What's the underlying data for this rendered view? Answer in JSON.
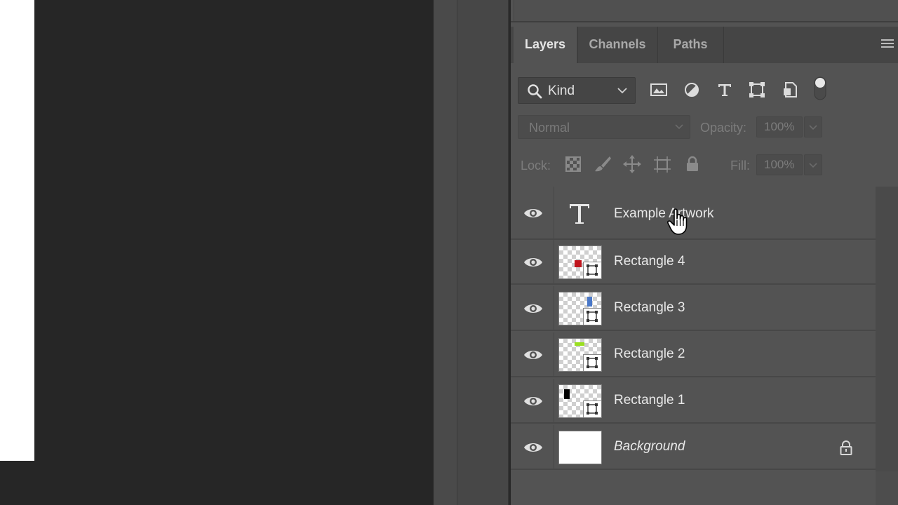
{
  "panel": {
    "tabs": [
      {
        "label": "Layers",
        "active": true
      },
      {
        "label": "Channels",
        "active": false
      },
      {
        "label": "Paths",
        "active": false
      }
    ],
    "menu_icon": "hamburger-menu-icon"
  },
  "filter": {
    "kind_label": "Kind",
    "icons": [
      "image-filter-icon",
      "adjustment-filter-icon",
      "type-filter-icon",
      "shape-filter-icon",
      "smart-object-filter-icon",
      "filter-toggle-icon"
    ]
  },
  "blend": {
    "mode": "Normal",
    "opacity_label": "Opacity:",
    "opacity_value": "100%"
  },
  "lock": {
    "label": "Lock:",
    "icons": [
      "lock-transparent-pixels-icon",
      "lock-image-pixels-icon",
      "lock-position-icon",
      "lock-artboard-icon",
      "lock-all-icon"
    ],
    "fill_label": "Fill:",
    "fill_value": "100%"
  },
  "layers": [
    {
      "name": "Example Artwork",
      "kind": "text",
      "visible": true
    },
    {
      "name": "Rectangle 4",
      "kind": "shape",
      "color": "#c0141c",
      "visible": true
    },
    {
      "name": "Rectangle 3",
      "kind": "shape",
      "color": "#4a78c8",
      "visible": true
    },
    {
      "name": "Rectangle 2",
      "kind": "shape",
      "color": "#9adf20",
      "visible": true
    },
    {
      "name": "Rectangle 1",
      "kind": "shape",
      "color": "#000000",
      "visible": true
    },
    {
      "name": "Background",
      "kind": "background",
      "visible": true,
      "locked": true
    }
  ],
  "colors": {
    "workspace": "#262626",
    "panel": "#535353",
    "tab_bar": "#454545",
    "document": "#ffffff"
  }
}
